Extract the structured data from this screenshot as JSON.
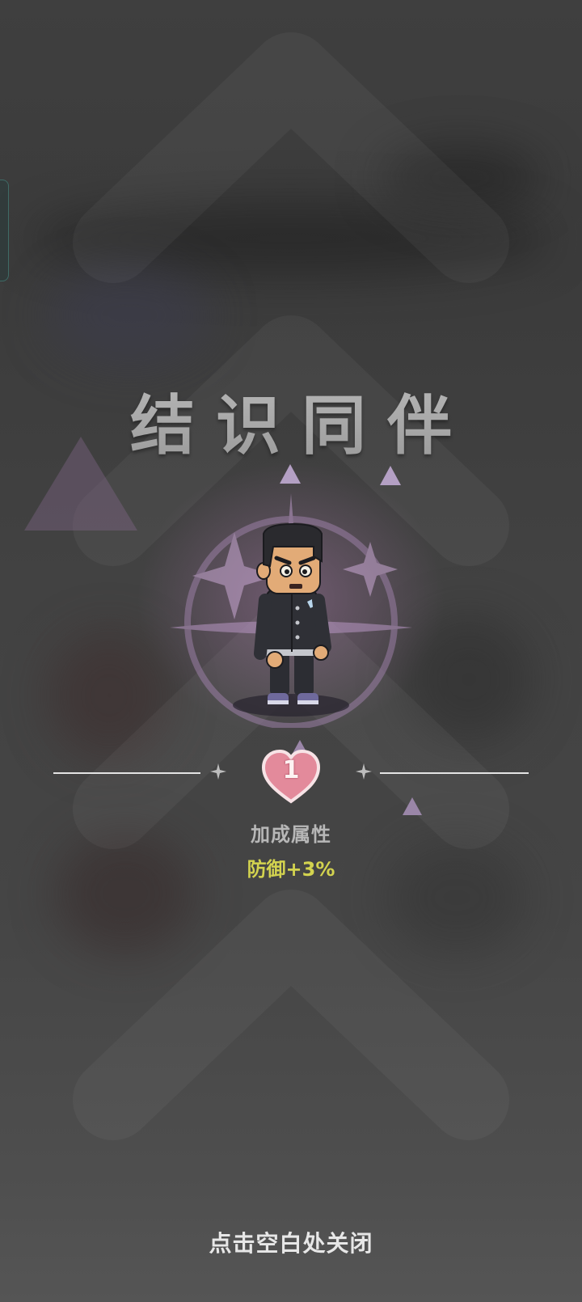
{
  "popup": {
    "title": "结识同伴",
    "level": "1",
    "bonus_label": "加成属性",
    "bonus_value": "防御+3%",
    "close_hint": "点击空白处关闭"
  },
  "icons": {
    "level": "heart-icon",
    "sparkle": "four-point-star-icon",
    "decoration": "triangle-icon",
    "background": "chevron-up-icon"
  },
  "colors": {
    "title": "#a9a9a9",
    "bonus_value": "#d3d34f",
    "heart": "#e38a9b",
    "glow": "#966e96"
  }
}
